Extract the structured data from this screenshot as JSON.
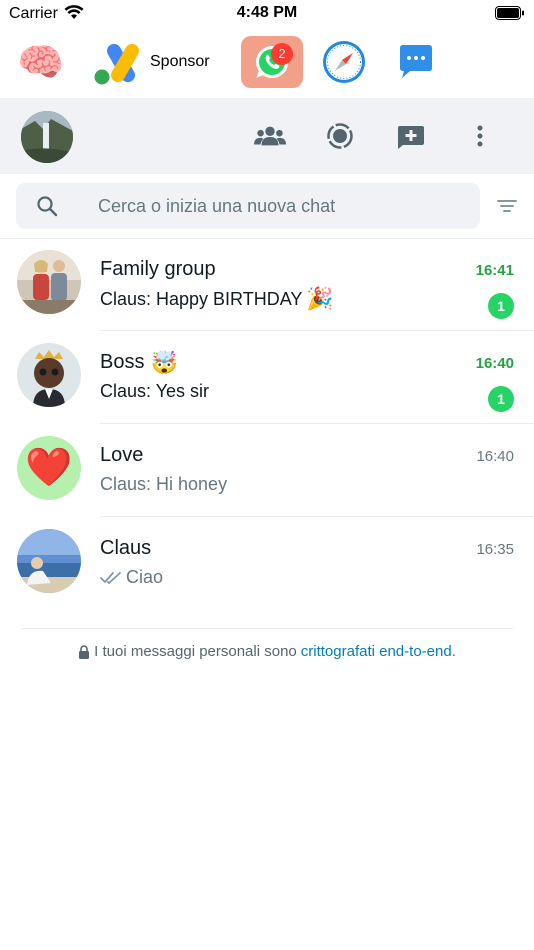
{
  "status_bar": {
    "carrier": "Carrier",
    "time": "4:48 PM"
  },
  "app_strip": {
    "sponsor_label": "Sponsor",
    "whatsapp_badge": "2",
    "icons": [
      "brain-icon",
      "google-ads-icon",
      "whatsapp-icon",
      "safari-icon",
      "messages-icon"
    ]
  },
  "header": {
    "icons": [
      "community-icon",
      "status-icon",
      "new-chat-icon",
      "more-options-icon"
    ]
  },
  "search": {
    "placeholder": "Cerca o inizia una nuova chat"
  },
  "chats": [
    {
      "name": "Family group",
      "preview": "Claus: Happy BIRTHDAY",
      "preview_emoji": "🎉",
      "time": "16:41",
      "unread": "1"
    },
    {
      "name": "Boss",
      "name_emoji": "🤯",
      "preview": "Claus: Yes sir",
      "time": "16:40",
      "unread": "1"
    },
    {
      "name": "Love",
      "preview": "Claus: Hi honey",
      "time": "16:40",
      "avatar_emoji": "❤️"
    },
    {
      "name": "Claus",
      "preview": "Ciao",
      "time": "16:35"
    }
  ],
  "footer": {
    "text": "I tuoi messaggi personali sono",
    "link": "crittografati end-to-end",
    "suffix": "."
  },
  "colors": {
    "accent_green": "#25d366",
    "unread_time_green": "#25a244",
    "header_bg": "#f0f2f5",
    "link_blue": "#027eb5",
    "badge_red": "#ff3b30"
  }
}
